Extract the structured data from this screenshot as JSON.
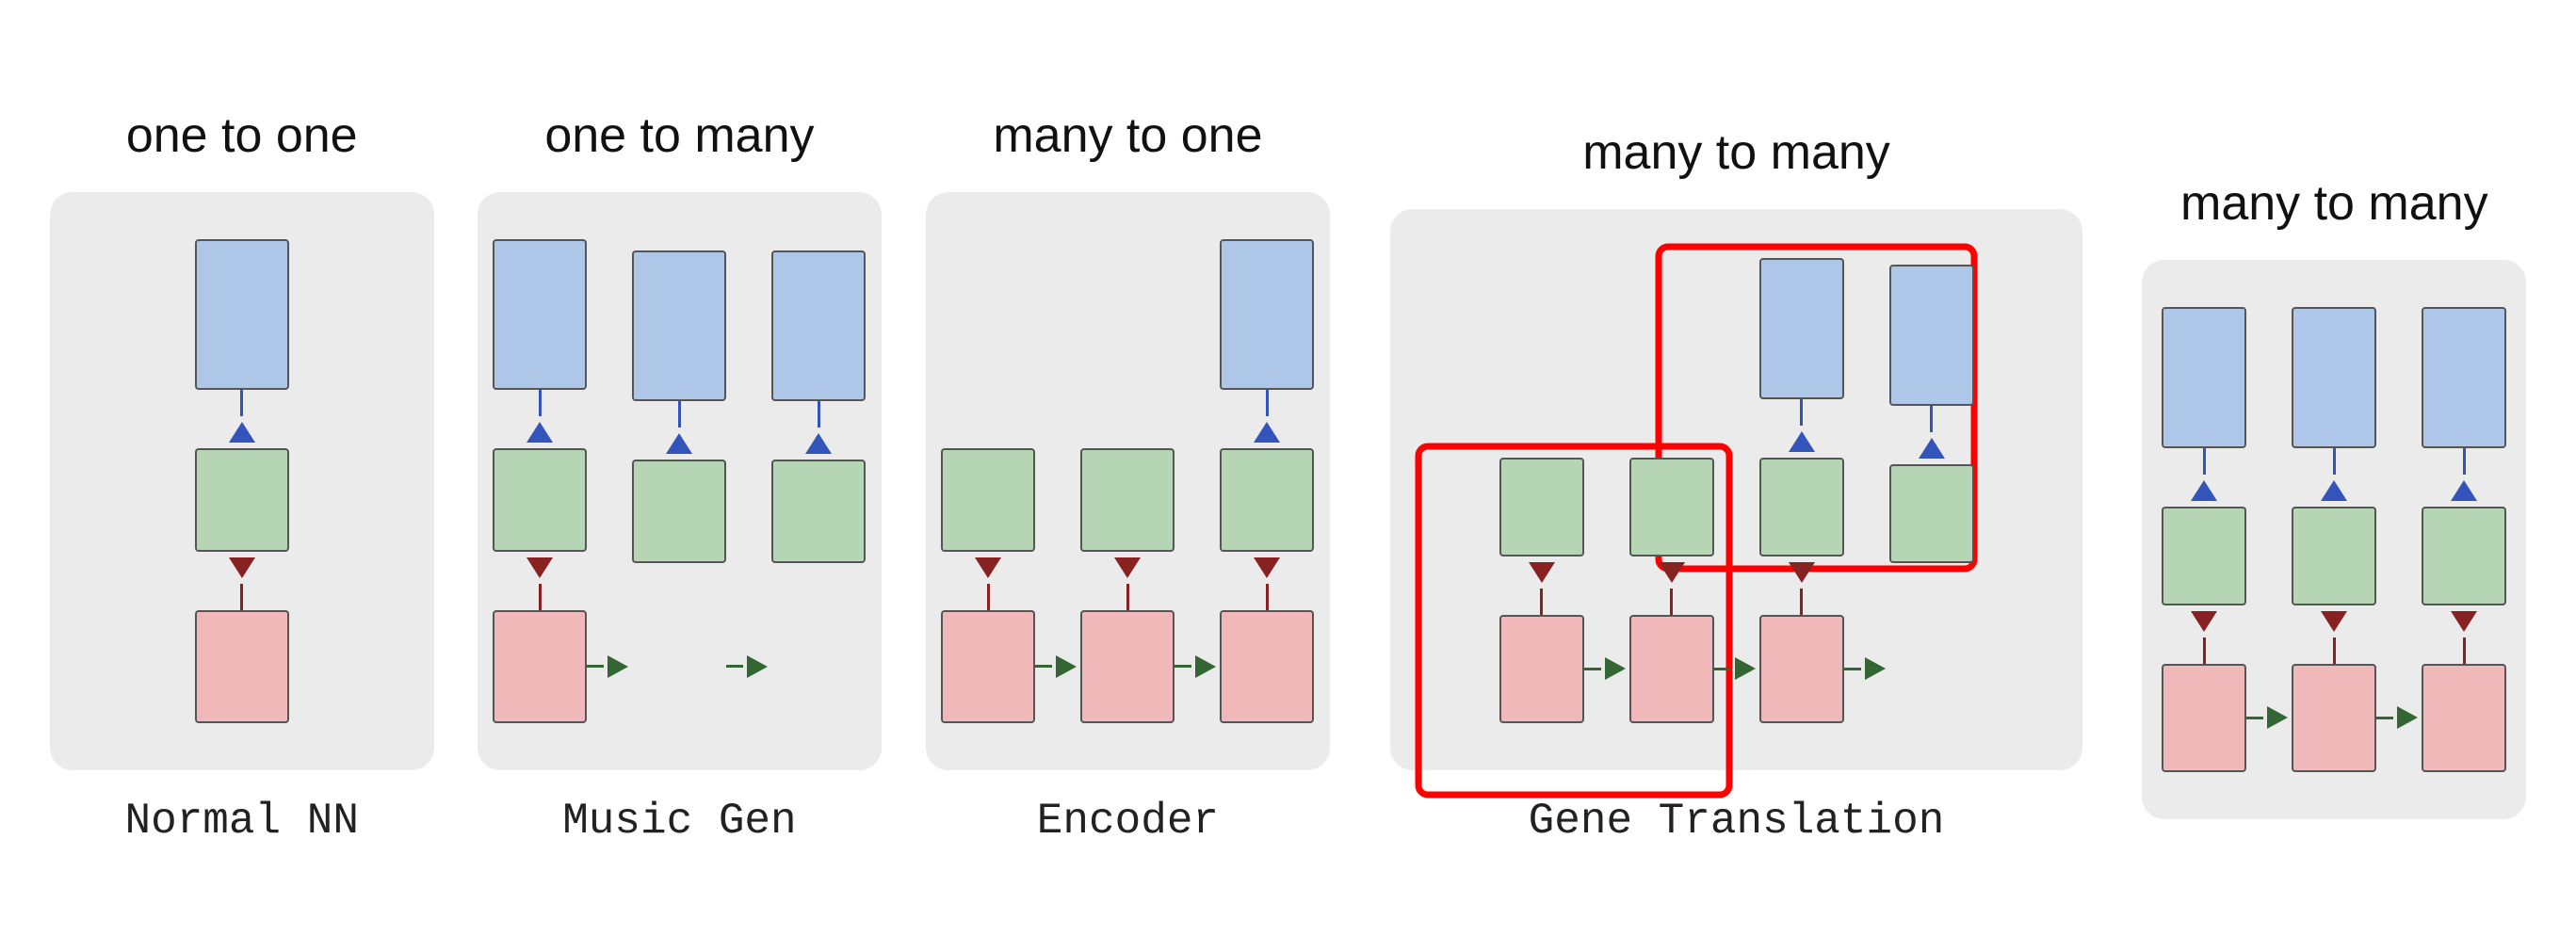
{
  "sections": [
    {
      "id": "one-to-one",
      "title": "one to one",
      "label": "Normal NN",
      "type": "one-to-one"
    },
    {
      "id": "one-to-many",
      "title": "one to many",
      "label": "Music Gen",
      "type": "one-to-many"
    },
    {
      "id": "many-to-one",
      "title": "many to one",
      "label": "Encoder",
      "type": "many-to-one"
    },
    {
      "id": "many-to-many-gene",
      "title": "many to many",
      "label": "Gene Translation",
      "type": "many-to-many-gene"
    },
    {
      "id": "many-to-many",
      "title": "many to many",
      "label": "",
      "type": "many-to-many"
    }
  ],
  "colors": {
    "blue": "#aec6e8",
    "green": "#b5d5b5",
    "pink": "#f0b8b8",
    "arrow_blue": "#3355bb",
    "arrow_red": "#882222",
    "arrow_green": "#336633",
    "card_bg": "#ebebeb",
    "red_highlight": "red"
  }
}
